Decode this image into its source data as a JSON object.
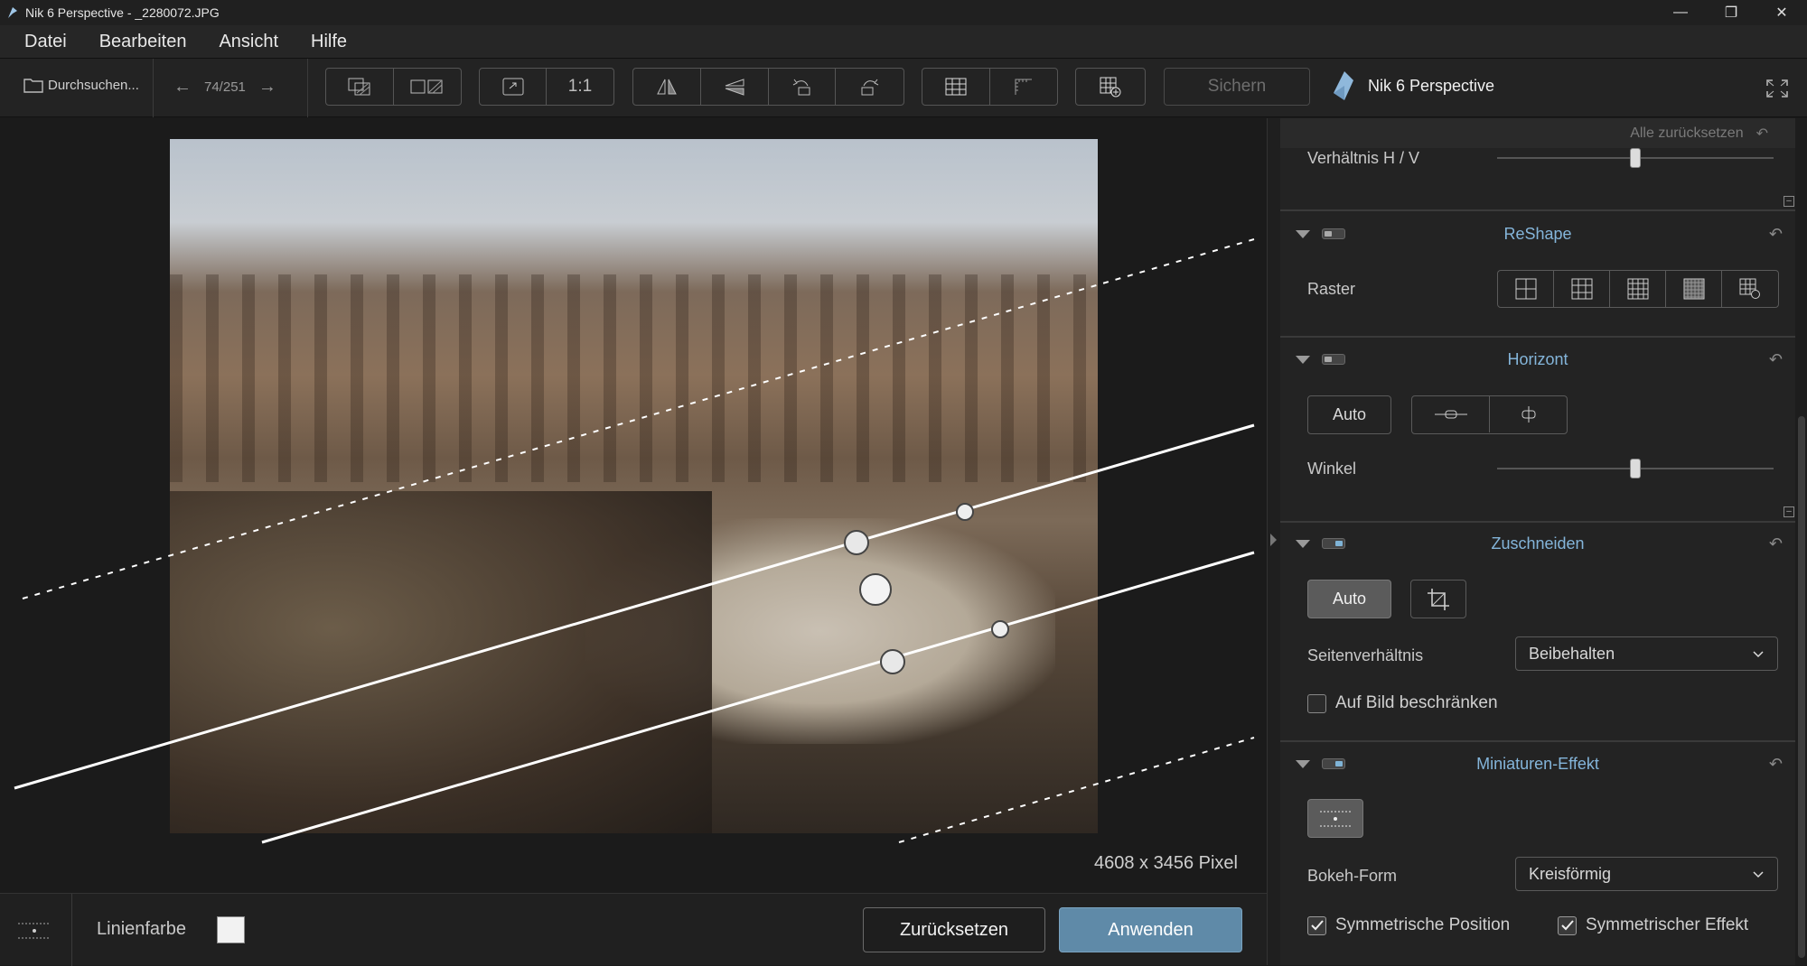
{
  "window": {
    "title": "Nik 6 Perspective - _2280072.JPG",
    "minimize": "—",
    "restore": "❐",
    "close": "✕"
  },
  "menu": [
    "Datei",
    "Bearbeiten",
    "Ansicht",
    "Hilfe"
  ],
  "toolbar": {
    "browse_label": "Durchsuchen...",
    "counter": "74/251",
    "zoom_1to1": "1:1",
    "save_label": "Sichern",
    "brand": "Nik 6 Perspective"
  },
  "canvas": {
    "dimensions": "4608 x 3456 Pixel"
  },
  "bottom": {
    "line_color_label": "Linienfarbe",
    "line_color": "#f2f2f2",
    "reset_label": "Zurücksetzen",
    "apply_label": "Anwenden"
  },
  "panel": {
    "reset_all": "Alle zurücksetzen",
    "ratio_label": "Verhältnis H / V",
    "ratio_value": 0.5,
    "reshape": {
      "title": "ReShape",
      "raster_label": "Raster"
    },
    "horizon": {
      "title": "Horizont",
      "auto": "Auto",
      "angle_label": "Winkel",
      "angle_value": 0.5
    },
    "crop": {
      "title": "Zuschneiden",
      "auto": "Auto",
      "aspect_label": "Seitenverhältnis",
      "aspect_value": "Beibehalten",
      "limit_label": "Auf Bild beschränken",
      "limit_checked": false
    },
    "miniature": {
      "title": "Miniaturen-Effekt",
      "bokeh_label": "Bokeh-Form",
      "bokeh_value": "Kreisförmig",
      "sym_pos_label": "Symmetrische Position",
      "sym_pos_checked": true,
      "sym_eff_label": "Symmetrischer Effekt",
      "sym_eff_checked": true
    }
  },
  "colors": {
    "accent": "#84b5da",
    "apply_button": "#5f8aa8"
  }
}
